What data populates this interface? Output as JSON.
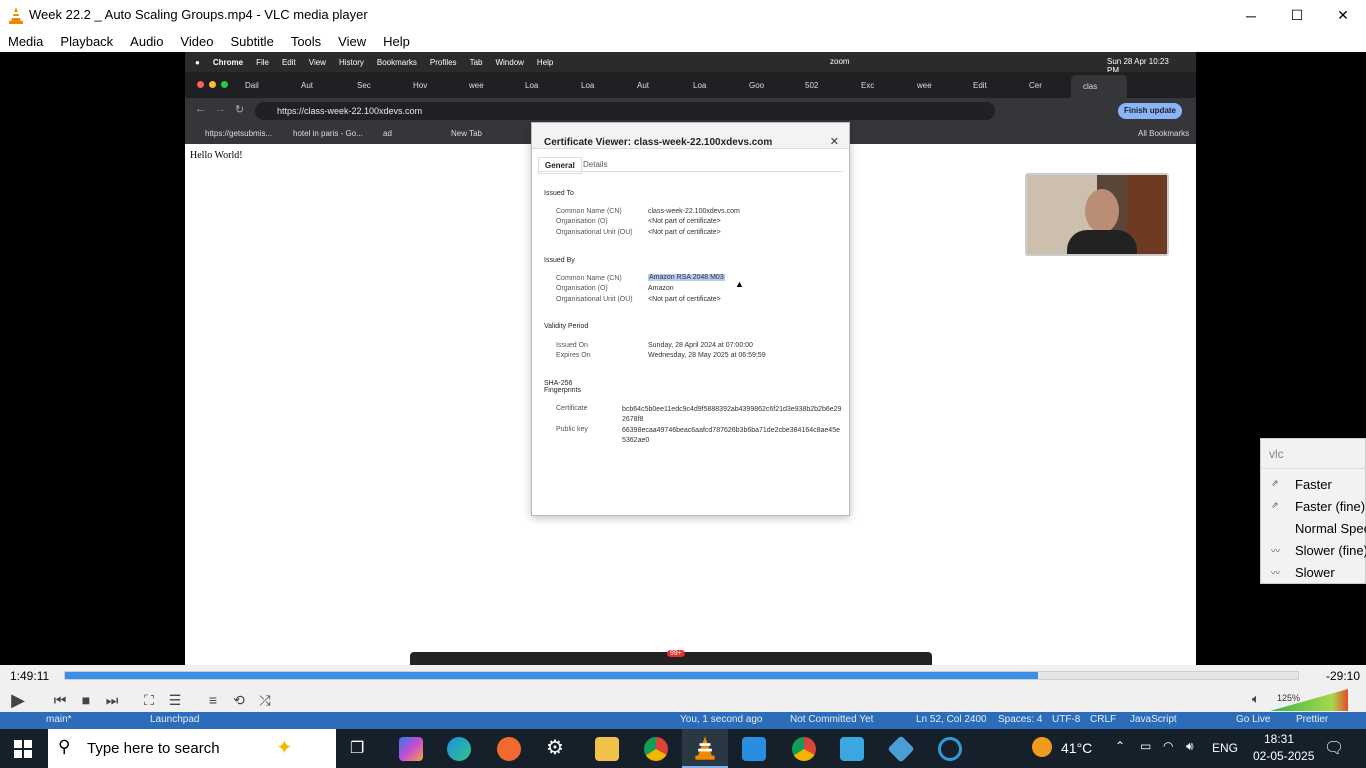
{
  "window": {
    "title": "Week 22.2 _ Auto Scaling Groups.mp4 - VLC media player",
    "minimize_glyph": "─",
    "maximize_glyph": "☐",
    "close_glyph": "✕"
  },
  "menu": [
    "Media",
    "Playback",
    "Audio",
    "Video",
    "Subtitle",
    "Tools",
    "View",
    "Help"
  ],
  "video_frame": {
    "mac_menu": [
      "Chrome",
      "File",
      "Edit",
      "View",
      "History",
      "Bookmarks",
      "Profiles",
      "Tab",
      "Window",
      "Help"
    ],
    "mac_status": {
      "app": "zoom",
      "datetime": "Sun 28 Apr 10:23 PM"
    },
    "tabs": [
      "Dail",
      "Aut",
      "Sec",
      "Hov",
      "wee",
      "Loa",
      "Loa",
      "Aut",
      "Loa",
      "Goo",
      "502",
      "Exc",
      "wee",
      "Edit",
      "Cer",
      "clas"
    ],
    "url": "https://class-week-22.100xdevs.com",
    "finish_update": "Finish update",
    "bookmarks": [
      "https://getsubmis...",
      "hotel in paris - Go...",
      "ad",
      "New Tab"
    ],
    "all_bookmarks": "All Bookmarks",
    "page_text": "Hello World!",
    "certificate": {
      "title": "Certificate Viewer: class-week-22.100xdevs.com",
      "tabs": [
        "General",
        "Details"
      ],
      "issued_to": {
        "heading": "Issued To",
        "rows": [
          {
            "label": "Common Name (CN)",
            "value": "class-week-22.100xdevs.com"
          },
          {
            "label": "Organisation (O)",
            "value": "<Not part of certificate>"
          },
          {
            "label": "Organisational Unit (OU)",
            "value": "<Not part of certificate>"
          }
        ]
      },
      "issued_by": {
        "heading": "Issued By",
        "rows": [
          {
            "label": "Common Name (CN)",
            "value": "Amazon RSA 2048 M03"
          },
          {
            "label": "Organisation (O)",
            "value": "Amazon"
          },
          {
            "label": "Organisational Unit (OU)",
            "value": "<Not part of certificate>"
          }
        ]
      },
      "validity": {
        "heading": "Validity Period",
        "rows": [
          {
            "label": "Issued On",
            "value": "Sunday, 28 April 2024 at 07:00:00"
          },
          {
            "label": "Expires On",
            "value": "Wednesday, 28 May 2025 at 06:59:59"
          }
        ]
      },
      "fingerprints": {
        "heading_1": "SHA-256",
        "heading_2": "Fingerprints",
        "rows": [
          {
            "label": "Certificate",
            "value": "bcb64c5b0ee11edc9c4d9f5888392ab4399862c6f21d3e938b2b2b6e292678f8"
          },
          {
            "label": "Public key",
            "value": "66398ecaa49746beac6aafcd787626b3b6ba71de2cbe384164c8ae45e5362ae0"
          }
        ]
      }
    },
    "zoom_badge": "99+"
  },
  "speed_menu": {
    "header": "vlc",
    "items": [
      "Faster",
      "Faster (fine)",
      "Normal Speed",
      "Slower (fine)",
      "Slower"
    ]
  },
  "controls": {
    "elapsed": "1:49:11",
    "remaining": "-29:10",
    "progress": 0.789,
    "volume_label": "125%",
    "volume_level": 1.25
  },
  "editor_strip": {
    "left": "main*",
    "middle": "Launchpad",
    "right_items": [
      "You, 1 second ago",
      "Not Committed Yet",
      "Ln 52, Col 2400",
      "Spaces: 4",
      "UTF-8",
      "CRLF",
      "JavaScript",
      "Go Live",
      "Prettier"
    ]
  },
  "taskbar": {
    "search_placeholder": "Type here to search",
    "temperature": "41°C",
    "language": "ENG",
    "time": "18:31",
    "date": "02-05-2025"
  },
  "colors": {
    "vlc_orange": "#f08a00",
    "seek_blue": "#3a8ee6",
    "taskbar": "#16202b",
    "selection": "#b6cdf0"
  }
}
